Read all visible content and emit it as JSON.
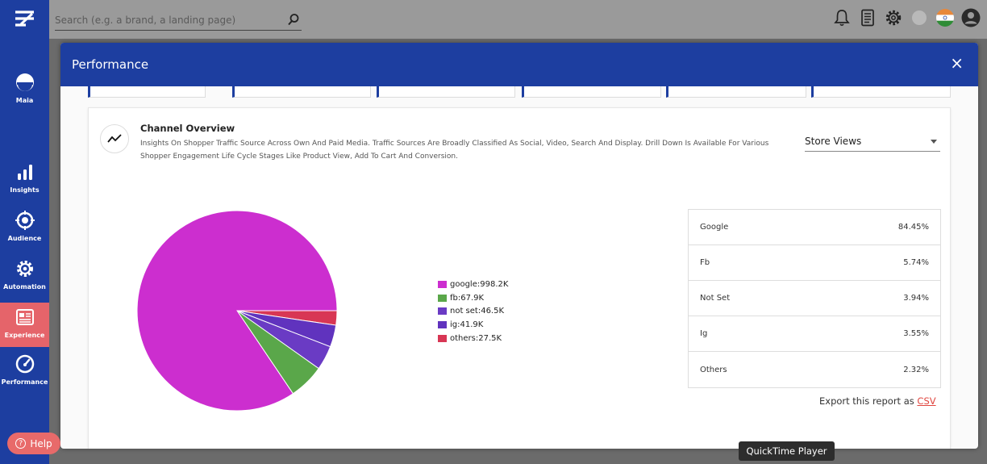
{
  "search": {
    "placeholder": "Search (e.g. a brand, a landing page)"
  },
  "sidebar": {
    "items": [
      {
        "label": "Maia",
        "icon": "maia-icon"
      },
      {
        "label": "Insights",
        "icon": "bar-chart-icon"
      },
      {
        "label": "Audience",
        "icon": "target-icon"
      },
      {
        "label": "Automation",
        "icon": "gear-icon"
      },
      {
        "label": "Experience",
        "icon": "layout-icon",
        "active": true
      },
      {
        "label": "Performance",
        "icon": "gauge-icon"
      }
    ],
    "help_label": "Help"
  },
  "modal": {
    "title": "Performance",
    "close_glyph": "×"
  },
  "card": {
    "title": "Channel Overview",
    "description": "Insights On Shopper Traffic Source Across Own And Paid Media. Traffic Sources Are Broadly Classified As Social, Video, Search And Display. Drill Down Is Available For Various Shopper Engagement Life Cycle Stages Like Product View, Add To Cart And Conversion.",
    "dropdown_value": "Store Views"
  },
  "colors": {
    "brand": "#1d3ea0",
    "active": "#e5646a",
    "google": "#cc2ecf",
    "fb": "#5aa74a",
    "not_set": "#6a3bc4",
    "ig": "#6033be",
    "others": "#d83654"
  },
  "chart_data": {
    "type": "pie",
    "series": [
      {
        "name": "google",
        "value": 998200,
        "label": "google:998.2K",
        "color": "#cc2ecf"
      },
      {
        "name": "fb",
        "value": 67900,
        "label": "fb:67.9K",
        "color": "#5aa74a"
      },
      {
        "name": "not set",
        "value": 46500,
        "label": "not set:46.5K",
        "color": "#6a3bc4"
      },
      {
        "name": "ig",
        "value": 41900,
        "label": "ig:41.9K",
        "color": "#6033be"
      },
      {
        "name": "others",
        "value": 27500,
        "label": "others:27.5K",
        "color": "#d83654"
      }
    ]
  },
  "stats": [
    {
      "label": "Google",
      "value": "84.45%"
    },
    {
      "label": "Fb",
      "value": "5.74%"
    },
    {
      "label": "Not Set",
      "value": "3.94%"
    },
    {
      "label": "Ig",
      "value": "3.55%"
    },
    {
      "label": "Others",
      "value": "2.32%"
    }
  ],
  "export": {
    "text": "Export this report as",
    "link": "CSV"
  },
  "tooltip": "QuickTime Player"
}
